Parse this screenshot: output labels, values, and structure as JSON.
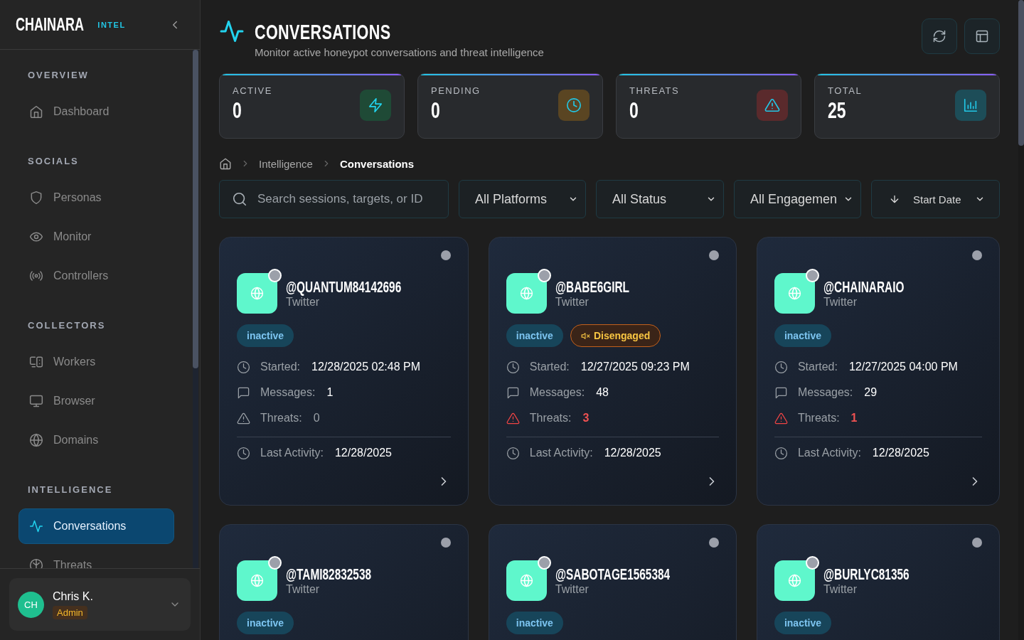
{
  "sidebar": {
    "logo": "CHAINARA",
    "logo_tag": "INTEL",
    "sections": [
      {
        "title": "OVERVIEW",
        "items": [
          {
            "label": "Dashboard",
            "kind": "home",
            "selected": false
          }
        ]
      },
      {
        "title": "SOCIALS",
        "items": [
          {
            "label": "Personas",
            "kind": "shield",
            "selected": false
          },
          {
            "label": "Monitor",
            "kind": "eye",
            "selected": false
          },
          {
            "label": "Controllers",
            "kind": "broadcast",
            "selected": false
          }
        ]
      },
      {
        "title": "COLLECTORS",
        "items": [
          {
            "label": "Workers",
            "kind": "devices",
            "selected": false
          },
          {
            "label": "Browser",
            "kind": "monitor",
            "selected": false
          },
          {
            "label": "Domains",
            "kind": "globe",
            "selected": false
          }
        ]
      },
      {
        "title": "INTELLIGENCE",
        "items": [
          {
            "label": "Conversations",
            "kind": "pulse",
            "selected": true
          },
          {
            "label": "Threats",
            "kind": "brain",
            "selected": false
          }
        ]
      }
    ],
    "user": {
      "initials": "CH",
      "name": "Chris K.",
      "role": "Admin"
    }
  },
  "header": {
    "title": "CONVERSATIONS",
    "subtitle": "Monitor active honeypot conversations and threat intelligence"
  },
  "stats": [
    {
      "label": "ACTIVE",
      "value": "0",
      "kind": "bolt",
      "color": "#1f4a36"
    },
    {
      "label": "PENDING",
      "value": "0",
      "kind": "clock",
      "color": "#5a4522"
    },
    {
      "label": "THREATS",
      "value": "0",
      "kind": "alert",
      "color": "#5a2a2c"
    },
    {
      "label": "TOTAL",
      "value": "25",
      "kind": "chart",
      "color": "#1d4d58"
    }
  ],
  "breadcrumb": [
    {
      "label": "Intelligence",
      "current": false
    },
    {
      "label": "Conversations",
      "current": true
    }
  ],
  "filters": {
    "search": {
      "placeholder": "Search sessions, targets, or ID"
    },
    "selects": [
      {
        "value": "All Platforms"
      },
      {
        "value": "All Status"
      },
      {
        "value": "All Engagemen"
      }
    ],
    "sort": {
      "label": "Start Date"
    }
  },
  "conversations": [
    {
      "handle": "@QUANTUM84142696",
      "platform": "Twitter",
      "status": "inactive",
      "fields": [
        {
          "kind": "time",
          "label": "Started:",
          "value": "12/28/2025 02:48 PM"
        },
        {
          "kind": "messages",
          "label": "Messages:",
          "value": "1"
        },
        {
          "kind": "threats",
          "label": "Threats:",
          "value": "0",
          "alert": false
        }
      ],
      "last_activity": {
        "label": "Last Activity:",
        "value": "12/28/2025"
      }
    },
    {
      "handle": "@BABE6GIRL",
      "platform": "Twitter",
      "status": "inactive",
      "engagement": "Disengaged",
      "fields": [
        {
          "kind": "time",
          "label": "Started:",
          "value": "12/27/2025 09:23 PM"
        },
        {
          "kind": "messages",
          "label": "Messages:",
          "value": "48"
        },
        {
          "kind": "threats",
          "label": "Threats:",
          "value": "3",
          "alert": true
        }
      ],
      "last_activity": {
        "label": "Last Activity:",
        "value": "12/28/2025"
      }
    },
    {
      "handle": "@CHAINARAIO",
      "platform": "Twitter",
      "status": "inactive",
      "fields": [
        {
          "kind": "time",
          "label": "Started:",
          "value": "12/27/2025 04:00 PM"
        },
        {
          "kind": "messages",
          "label": "Messages:",
          "value": "29"
        },
        {
          "kind": "threats",
          "label": "Threats:",
          "value": "1",
          "alert": true
        }
      ],
      "last_activity": {
        "label": "Last Activity:",
        "value": "12/28/2025"
      }
    },
    {
      "handle": "@TAMI82832538",
      "platform": "Twitter",
      "status": "inactive"
    },
    {
      "handle": "@SABOTAGE1565384",
      "platform": "Twitter",
      "status": "inactive"
    },
    {
      "handle": "@BURLYC81356",
      "platform": "Twitter",
      "status": "inactive"
    }
  ]
}
